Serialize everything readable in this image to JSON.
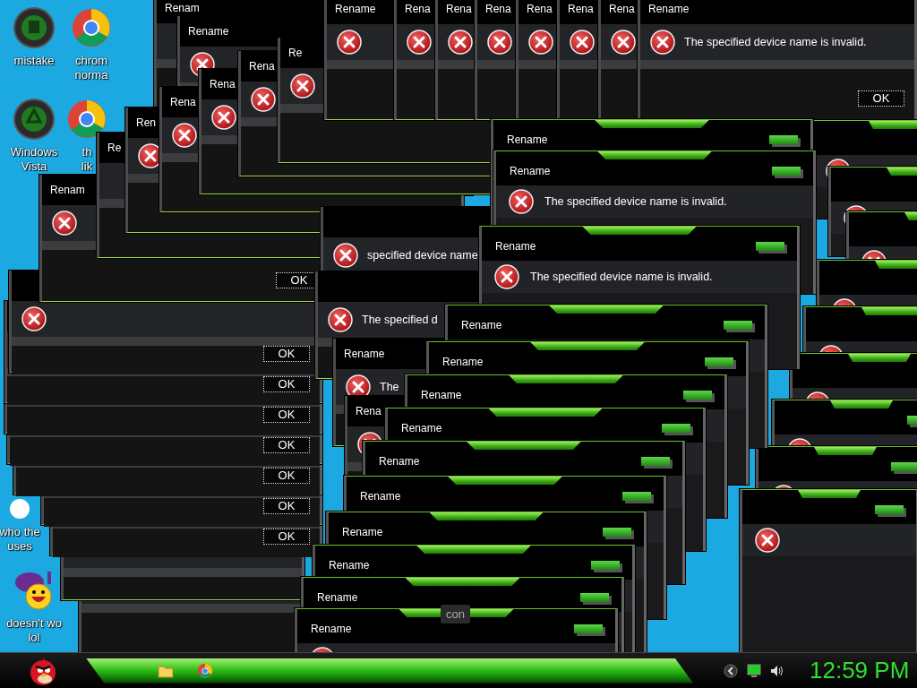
{
  "desktop_icons": [
    {
      "kind": "disc",
      "lines": [
        "mistake"
      ]
    },
    {
      "kind": "browser",
      "lines": [
        "chrom",
        "norma"
      ]
    },
    {
      "kind": "recycle",
      "lines": [
        "Windows",
        "Vista"
      ]
    },
    {
      "kind": "browser",
      "lines": [
        "th",
        "lik"
      ]
    },
    {
      "kind": "blank",
      "lines": [
        "who the",
        "uses"
      ]
    },
    {
      "kind": "smiley",
      "lines": [
        "doesn't wo",
        "lol"
      ]
    }
  ],
  "windows": [
    {
      "kind": "plain",
      "ok": "OK"
    },
    {
      "kind": "plain",
      "ok": "OK"
    },
    {
      "kind": "plain",
      "ok": "OK"
    },
    {
      "kind": "plain",
      "ok": "OK"
    },
    {
      "kind": "plain",
      "ok": "OK"
    },
    {
      "kind": "plain",
      "ok": "OK"
    },
    {
      "kind": "plain",
      "ok": "OK"
    },
    {
      "kind": "plain"
    },
    {
      "kind": "plain"
    },
    {
      "kind": "plain",
      "title": "Renam"
    },
    {
      "kind": "plain",
      "title": "Rename"
    },
    {
      "kind": "plain",
      "title": "Renam",
      "ok": "OK"
    },
    {
      "kind": "plain",
      "title": "Re"
    },
    {
      "kind": "plain",
      "title": "Ren"
    },
    {
      "kind": "plain",
      "title": "Rena"
    },
    {
      "kind": "plain",
      "title": "Rena"
    },
    {
      "kind": "plain",
      "title": "Rena"
    },
    {
      "kind": "plain",
      "title": "Re"
    },
    {
      "kind": "plain",
      "title": "Rename"
    },
    {
      "kind": "plain",
      "title": "Rena"
    },
    {
      "kind": "plain",
      "title": "Rena"
    },
    {
      "kind": "plain",
      "title": "Rena"
    },
    {
      "kind": "plain",
      "title": "Rena"
    },
    {
      "kind": "plain",
      "title": "Rena"
    },
    {
      "kind": "plain",
      "title": "Rena"
    },
    {
      "kind": "plain",
      "title": "Rename",
      "message": "The specified device name is invalid.",
      "ok": "OK"
    },
    {
      "kind": "glow"
    },
    {
      "kind": "glow"
    },
    {
      "kind": "glow"
    },
    {
      "kind": "glow"
    },
    {
      "kind": "glow"
    },
    {
      "kind": "glow"
    },
    {
      "kind": "glow"
    },
    {
      "kind": "glow"
    },
    {
      "kind": "glow"
    },
    {
      "kind": "plain",
      "message": "specified device name"
    },
    {
      "kind": "plain",
      "message": "The specified d"
    },
    {
      "kind": "plain",
      "title": "Rename",
      "message": "The"
    },
    {
      "kind": "plain",
      "title": "Rena"
    },
    {
      "kind": "glow",
      "title": "Rename"
    },
    {
      "kind": "glow",
      "title": "Rename",
      "message": "The specified device name is invalid."
    },
    {
      "kind": "glow",
      "title": "Rename",
      "message": "The specified device name is invalid."
    },
    {
      "kind": "glow",
      "title": "Rename"
    },
    {
      "kind": "glow",
      "title": "Rename"
    },
    {
      "kind": "glow",
      "title": "Rename"
    },
    {
      "kind": "glow",
      "title": "Rename"
    },
    {
      "kind": "glow",
      "title": "Rename"
    },
    {
      "kind": "glow",
      "title": "Rename"
    },
    {
      "kind": "glow",
      "title": "Rename"
    },
    {
      "kind": "glow",
      "title": "Rename"
    },
    {
      "kind": "glow",
      "title": "Rename"
    },
    {
      "kind": "glow",
      "title": "Rename"
    }
  ],
  "tooltip": "con",
  "taskbar": {
    "clock": "12:59 PM"
  }
}
